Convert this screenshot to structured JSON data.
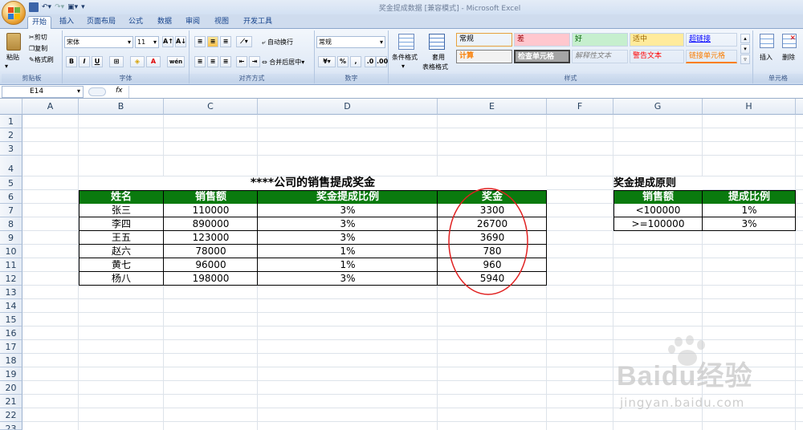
{
  "window": {
    "title": "奖金提成数据  [兼容模式] - Microsoft Excel"
  },
  "tabs": [
    "开始",
    "插入",
    "页面布局",
    "公式",
    "数据",
    "审阅",
    "视图",
    "开发工具"
  ],
  "ribbon": {
    "clipboard": {
      "paste": "粘贴",
      "cut": "剪切",
      "copy": "复制",
      "format_painter": "格式刷",
      "label": "剪贴板"
    },
    "font": {
      "name": "宋体",
      "size": "11",
      "label": "字体",
      "bold": "B",
      "italic": "I",
      "underline": "U",
      "grow": "A↑",
      "shrink": "A↓",
      "color": "A",
      "phonetic": "wén"
    },
    "alignment": {
      "wrap": "自动换行",
      "merge": "合并后居中",
      "label": "对齐方式"
    },
    "number": {
      "format": "常规",
      "label": "数字",
      "percent": "%",
      "comma": ","
    },
    "styles": {
      "conditional": "条件格式",
      "table": "套用",
      "table2": "表格格式",
      "label": "样式",
      "cells": [
        {
          "text": "常规",
          "bg": "#ffffff",
          "fg": "#000000"
        },
        {
          "text": "差",
          "bg": "#ffc7ce",
          "fg": "#9c0006"
        },
        {
          "text": "好",
          "bg": "#c6efce",
          "fg": "#006100"
        },
        {
          "text": "适中",
          "bg": "#ffeb9c",
          "fg": "#9c6500"
        },
        {
          "text": "超链接",
          "bg": "#ffffff",
          "fg": "#0000ff"
        },
        {
          "text": "计算",
          "bg": "#f2f2f2",
          "fg": "#fa7d00"
        },
        {
          "text": "检查单元格",
          "bg": "#a5a5a5",
          "fg": "#ffffff"
        },
        {
          "text": "解释性文本",
          "bg": "#ffffff",
          "fg": "#7f7f7f"
        },
        {
          "text": "警告文本",
          "bg": "#ffffff",
          "fg": "#ff0000"
        },
        {
          "text": "链接单元格",
          "bg": "#ffffff",
          "fg": "#fa7d00"
        }
      ]
    },
    "cells_group": {
      "insert": "插入",
      "delete": "删除",
      "label": "单元格"
    }
  },
  "formula_bar": {
    "name_box": "E14",
    "fx": "fx",
    "value": ""
  },
  "columns": [
    "A",
    "B",
    "C",
    "D",
    "E",
    "F",
    "G",
    "H"
  ],
  "rows": [
    "1",
    "2",
    "3",
    "4",
    "5",
    "6",
    "7",
    "8",
    "9",
    "10",
    "11",
    "12",
    "13",
    "14",
    "15",
    "16",
    "17",
    "18",
    "19",
    "20",
    "21",
    "22",
    "23"
  ],
  "sheet": {
    "main_title": "****公司的销售提成奖金",
    "headers": [
      "姓名",
      "销售额",
      "奖金提成比例",
      "奖金"
    ],
    "rows": [
      [
        "张三",
        "110000",
        "3%",
        "3300"
      ],
      [
        "李四",
        "890000",
        "3%",
        "26700"
      ],
      [
        "王五",
        "123000",
        "3%",
        "3690"
      ],
      [
        "赵六",
        "78000",
        "1%",
        "780"
      ],
      [
        "黄七",
        "96000",
        "1%",
        "960"
      ],
      [
        "杨八",
        "198000",
        "3%",
        "5940"
      ]
    ],
    "rule_title": "奖金提成原则",
    "rule_headers": [
      "销售额",
      "提成比例"
    ],
    "rule_rows": [
      [
        "<100000",
        "1%"
      ],
      [
        ">=100000",
        "3%"
      ]
    ]
  },
  "watermark": {
    "brand": "Baidu经验",
    "url": "jingyan.baidu.com"
  },
  "colors": {
    "header_green": "#0a7a0e",
    "annotation_red": "#e02020"
  }
}
